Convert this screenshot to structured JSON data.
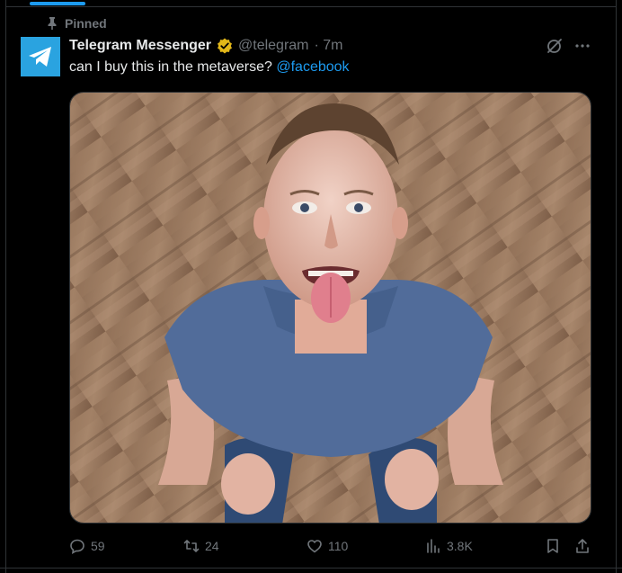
{
  "pinned_label": "Pinned",
  "author": {
    "name": "Telegram Messenger",
    "handle": "@telegram",
    "time": "· 7m"
  },
  "tweet": {
    "text": "can I buy this in the metaverse?",
    "mention": "@facebook"
  },
  "actions": {
    "replies": "59",
    "reposts": "24",
    "likes": "110",
    "views": "3.8K"
  },
  "colors": {
    "accent": "#1d9bf0",
    "verified_gold": "#e2b719",
    "telegram_blue": "#2aa3e0"
  },
  "icons": [
    "pin-icon",
    "telegram-logo-icon",
    "verified-badge-icon",
    "grok-icon",
    "more-icon",
    "reply-icon",
    "repost-icon",
    "like-icon",
    "views-icon",
    "bookmark-icon",
    "share-icon"
  ]
}
